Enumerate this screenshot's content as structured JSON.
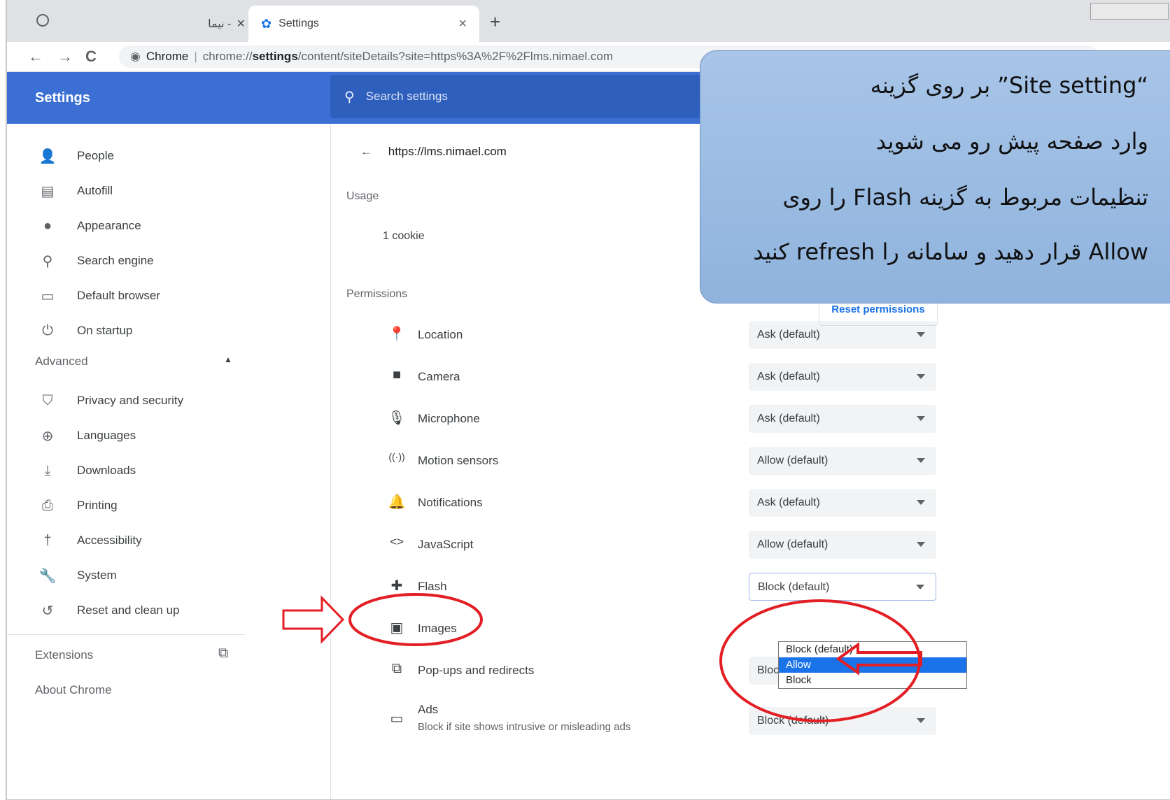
{
  "browser": {
    "tabs": [
      {
        "label": "- نیما",
        "close": "×"
      },
      {
        "label": "Settings",
        "close": "×"
      }
    ],
    "new_tab": "+",
    "nav": {
      "back": "←",
      "forward": "→",
      "reload": "C"
    },
    "omnibox": {
      "site_label": "Chrome",
      "url_prefix": "chrome://",
      "url_bold": "settings",
      "url_rest": "/content/siteDetails?site=https%3A%2F%2Flms.nimael.com"
    }
  },
  "header": {
    "title": "Settings",
    "search_placeholder": "Search settings"
  },
  "sidebar": {
    "items": [
      {
        "label": "People",
        "icon": "person-icon"
      },
      {
        "label": "Autofill",
        "icon": "clipboard-icon"
      },
      {
        "label": "Appearance",
        "icon": "palette-icon"
      },
      {
        "label": "Search engine",
        "icon": "search-icon"
      },
      {
        "label": "Default browser",
        "icon": "browser-icon"
      },
      {
        "label": "On startup",
        "icon": "power-icon"
      }
    ],
    "advanced_label": "Advanced",
    "advanced_items": [
      {
        "label": "Privacy and security",
        "icon": "shield-icon"
      },
      {
        "label": "Languages",
        "icon": "globe-icon"
      },
      {
        "label": "Downloads",
        "icon": "download-icon"
      },
      {
        "label": "Printing",
        "icon": "printer-icon"
      },
      {
        "label": "Accessibility",
        "icon": "accessibility-icon"
      },
      {
        "label": "System",
        "icon": "wrench-icon"
      },
      {
        "label": "Reset and clean up",
        "icon": "restore-icon"
      }
    ],
    "extensions_label": "Extensions",
    "about_label": "About Chrome"
  },
  "site": {
    "url": "https://lms.nimael.com",
    "usage_heading": "Usage",
    "usage_value": "1 cookie",
    "permissions_heading": "Permissions",
    "reset_button": "Reset permissions",
    "permissions": [
      {
        "label": "Location",
        "value": "Ask (default)",
        "icon": "location-pin-icon"
      },
      {
        "label": "Camera",
        "value": "Ask (default)",
        "icon": "camera-icon"
      },
      {
        "label": "Microphone",
        "value": "Ask (default)",
        "icon": "microphone-icon"
      },
      {
        "label": "Motion sensors",
        "value": "Allow (default)",
        "icon": "sensor-icon"
      },
      {
        "label": "Notifications",
        "value": "Ask (default)",
        "icon": "bell-icon"
      },
      {
        "label": "JavaScript",
        "value": "Allow (default)",
        "icon": "code-icon"
      },
      {
        "label": "Flash",
        "value": "Block (default)",
        "icon": "puzzle-icon"
      },
      {
        "label": "Images",
        "value": "",
        "icon": "image-icon"
      },
      {
        "label": "Pop-ups and redirects",
        "value": "Block (default)",
        "icon": "open-new-icon"
      },
      {
        "label": "Ads",
        "sublabel": "Block if site shows intrusive or misleading ads",
        "value": "Block (default)",
        "icon": "ads-icon"
      }
    ],
    "flash_dropdown_options": [
      "Block (default)",
      "Allow",
      "Block"
    ],
    "flash_dropdown_highlight": "Allow"
  },
  "callout": {
    "lines": [
      "“Site setting” بر روی گزینه",
      "وارد صفحه پیش رو می شوید",
      "تنظیمات مربوط به گزینه Flash را روی",
      "Allow قرار دهید و سامانه را refresh کنید"
    ]
  },
  "annotation_colors": {
    "red": "#e31e24"
  }
}
